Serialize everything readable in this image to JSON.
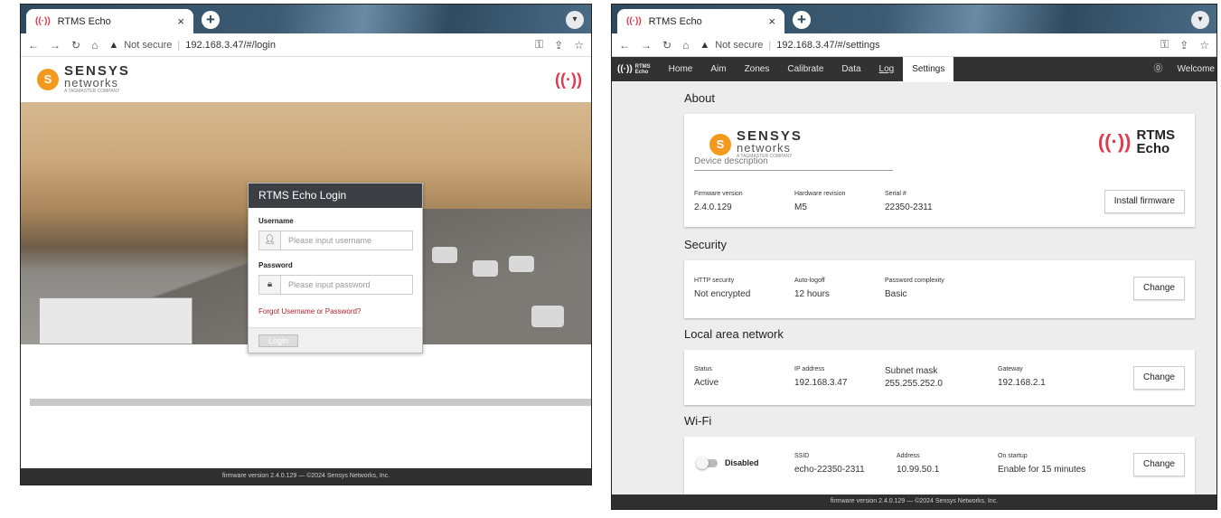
{
  "browser": {
    "tab_title": "RTMS Echo",
    "close_glyph": "×",
    "newtab_glyph": "+",
    "not_secure": "Not secure",
    "login_url": "192.168.3.47/#/login",
    "settings_url": "192.168.3.47/#/settings"
  },
  "brand": {
    "company_line1": "SENSYS",
    "company_line2": "networks",
    "company_line3": "A TAGMASTER COMPANY",
    "logo_mark": "S"
  },
  "login": {
    "title": "RTMS Echo Login",
    "username_label": "Username",
    "username_placeholder": "Please input username",
    "password_label": "Password",
    "password_placeholder": "Please input password",
    "forgot": "Forgot Username or Password?",
    "login_button": "Login"
  },
  "footer": "firmware version 2.4.0.129 — ©2024 Sensys Networks, Inc.",
  "nav": {
    "brand_top": "RTMS",
    "brand_bottom": "Echo",
    "items": [
      "Home",
      "Aim",
      "Zones",
      "Calibrate",
      "Data",
      "Log",
      "Settings"
    ],
    "welcome": "Welcome"
  },
  "settings": {
    "about": {
      "heading": "About",
      "rtms_logo_top": "RTMS",
      "rtms_logo_bottom": "Echo",
      "device_description_label": "Device description",
      "firmware_label": "Firmware version",
      "firmware_value": "2.4.0.129",
      "hardware_label": "Hardware revision",
      "hardware_value": "M5",
      "serial_label": "Serial #",
      "serial_value": "22350-2311",
      "install_button": "Install firmware"
    },
    "security": {
      "heading": "Security",
      "http_label": "HTTP security",
      "http_value": "Not encrypted",
      "logoff_label": "Auto-logoff",
      "logoff_value": "12 hours",
      "complexity_label": "Password complexity",
      "complexity_value": "Basic",
      "change_button": "Change"
    },
    "lan": {
      "heading": "Local area network",
      "status_label": "Status",
      "status_value": "Active",
      "ip_label": "IP address",
      "ip_value": "192.168.3.47",
      "subnet_label": "Subnet mask",
      "subnet_value": "255.255.252.0",
      "gateway_label": "Gateway",
      "gateway_value": "192.168.2.1",
      "change_button": "Change"
    },
    "wifi": {
      "heading": "Wi-Fi",
      "toggle_label": "Disabled",
      "ssid_label": "SSID",
      "ssid_value": "echo-22350-2311",
      "address_label": "Address",
      "address_value": "10.99.50.1",
      "startup_label": "On startup",
      "startup_value": "Enable for 15 minutes",
      "change_button": "Change"
    }
  },
  "colors": {
    "accent_red": "#e23a4a",
    "nav_dark": "#323232",
    "logo_orange": "#f39a1e"
  }
}
